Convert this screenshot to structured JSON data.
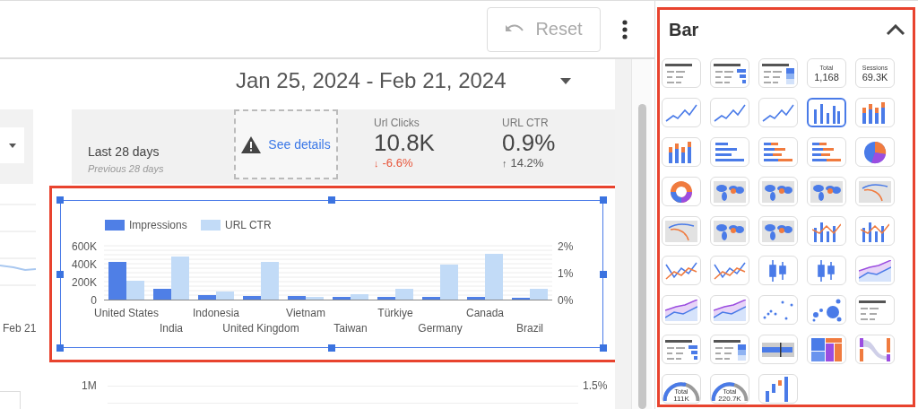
{
  "toolbar": {
    "reset_label": "Reset",
    "reset_disabled": true
  },
  "report": {
    "date_range": "Jan 25, 2024 - Feb 21, 2024",
    "left_chart": {
      "x_label": "Feb 21"
    },
    "scorecard_strip": {
      "period": "Last 28 days",
      "comparison": "Previous 28 days",
      "warning": "See details",
      "metrics": [
        {
          "label": "Url Clicks",
          "value": "10.8K",
          "arrow": "↓",
          "delta": "-6.6%",
          "color": "#e8553a"
        },
        {
          "label": "URL CTR",
          "value": "0.9%",
          "arrow": "↑",
          "delta": "14.2%",
          "color": "#555555"
        }
      ]
    },
    "selected_chart": {
      "chart_data": {
        "type": "bar",
        "categories": [
          "United States",
          "India",
          "Indonesia",
          "United Kingdom",
          "Vietnam",
          "Taiwan",
          "Türkiye",
          "Germany",
          "Canada",
          "Brazil"
        ],
        "series": [
          {
            "name": "Impressions",
            "color": "#4f7fe6",
            "values": [
              420000,
              120000,
              50000,
              40000,
              40000,
              30000,
              30000,
              30000,
              30000,
              20000
            ]
          },
          {
            "name": "URL CTR",
            "color": "#c2dbf7",
            "axis": "y2",
            "values": [
              0.7,
              1.6,
              0.3,
              1.4,
              0.1,
              0.2,
              0.4,
              1.3,
              1.7,
              0.4
            ]
          }
        ],
        "grid": true,
        "legend": "top",
        "ylim": [
          0,
          600000
        ],
        "y2lim": [
          0,
          2
        ],
        "yticks": [
          {
            "value": 0,
            "label": "0"
          },
          {
            "value": 200000,
            "label": "200K"
          },
          {
            "value": 400000,
            "label": "400K"
          },
          {
            "value": 600000,
            "label": "600K"
          }
        ],
        "y2ticks": [
          {
            "value": 0,
            "label": "0%"
          },
          {
            "value": 1,
            "label": "1%"
          },
          {
            "value": 2,
            "label": "2%"
          }
        ]
      }
    },
    "lower_chart": {
      "left_tick": "1M",
      "right_tick": "1.5%"
    }
  },
  "panel": {
    "title": "Bar",
    "expanded": true,
    "charts": [
      {
        "kind": "table",
        "selected": false
      },
      {
        "kind": "table-bars",
        "selected": false
      },
      {
        "kind": "table-heatmap",
        "selected": false
      },
      {
        "kind": "scorecard",
        "label": "Total",
        "value": "1,168",
        "selected": false
      },
      {
        "kind": "scorecard",
        "label": "Sessions",
        "value": "69.3K",
        "selected": false
      },
      {
        "kind": "line",
        "selected": false
      },
      {
        "kind": "line",
        "selected": false
      },
      {
        "kind": "line",
        "selected": false
      },
      {
        "kind": "bar",
        "selected": true
      },
      {
        "kind": "bar-stacked",
        "selected": false
      },
      {
        "kind": "bar-stacked",
        "selected": false
      },
      {
        "kind": "hbar",
        "selected": false
      },
      {
        "kind": "hbar-stacked",
        "selected": false
      },
      {
        "kind": "hbar-stacked",
        "selected": false
      },
      {
        "kind": "pie",
        "selected": false
      },
      {
        "kind": "donut",
        "selected": false
      },
      {
        "kind": "map",
        "selected": false
      },
      {
        "kind": "map",
        "selected": false
      },
      {
        "kind": "map",
        "selected": false
      },
      {
        "kind": "flow-map",
        "selected": false
      },
      {
        "kind": "flow-map",
        "selected": false
      },
      {
        "kind": "map",
        "selected": false
      },
      {
        "kind": "map",
        "selected": false
      },
      {
        "kind": "combo",
        "selected": false
      },
      {
        "kind": "combo",
        "selected": false
      },
      {
        "kind": "line-multi",
        "selected": false
      },
      {
        "kind": "line-multi",
        "selected": false
      },
      {
        "kind": "candlestick",
        "selected": false
      },
      {
        "kind": "candlestick",
        "selected": false
      },
      {
        "kind": "area",
        "selected": false
      },
      {
        "kind": "area",
        "selected": false
      },
      {
        "kind": "area",
        "selected": false
      },
      {
        "kind": "scatter",
        "selected": false
      },
      {
        "kind": "bubble",
        "selected": false
      },
      {
        "kind": "table",
        "selected": false
      },
      {
        "kind": "table-bars",
        "selected": false
      },
      {
        "kind": "table-heatmap",
        "selected": false
      },
      {
        "kind": "bullet",
        "selected": false
      },
      {
        "kind": "treemap",
        "selected": false
      },
      {
        "kind": "sankey",
        "selected": false
      },
      {
        "kind": "gauge",
        "label": "Total",
        "value": "111K",
        "selected": false
      },
      {
        "kind": "gauge",
        "label": "Total",
        "value": "220.7K",
        "selected": false
      },
      {
        "kind": "waterfall",
        "selected": false
      }
    ]
  }
}
